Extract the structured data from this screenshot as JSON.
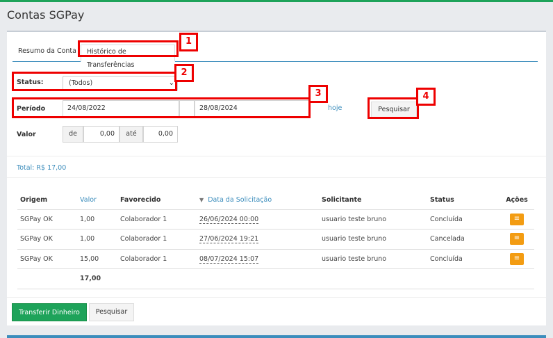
{
  "page": {
    "title": "Contas SGPay"
  },
  "tabs": [
    {
      "label": "Resumo da Conta"
    },
    {
      "label": "Histórico de Transferências"
    }
  ],
  "filters": {
    "status_label": "Status:",
    "status_value": "(Todos)",
    "periodo_label": "Período",
    "date_from": "24/08/2022",
    "date_to": "28/08/2024",
    "hoje_link": "hoje",
    "search_button": "Pesquisar",
    "valor_label": "Valor",
    "de_label": "de",
    "de_value": "0,00",
    "ate_label": "até",
    "ate_value": "0,00"
  },
  "total": "Total: R$ 17,00",
  "table": {
    "headers": [
      "Origem",
      "Valor",
      "Favorecido",
      "Data da Solicitação",
      "Solicitante",
      "Status",
      "Ações"
    ],
    "rows": [
      {
        "origem": "SGPay OK",
        "valor": "1,00",
        "favorecido": "Colaborador 1",
        "data": "26/06/2024 00:00",
        "solicitante": "usuario teste bruno",
        "status": "Concluída"
      },
      {
        "origem": "SGPay OK",
        "valor": "1,00",
        "favorecido": "Colaborador 1",
        "data": "27/06/2024 19:21",
        "solicitante": "usuario teste bruno",
        "status": "Cancelada"
      },
      {
        "origem": "SGPay OK",
        "valor": "15,00",
        "favorecido": "Colaborador 1",
        "data": "08/07/2024 15:07",
        "solicitante": "usuario teste bruno",
        "status": "Concluída"
      }
    ],
    "footer_total": "17,00"
  },
  "footer_buttons": {
    "transfer": "Transferir Dinheiro",
    "search": "Pesquisar"
  },
  "annotations": [
    "1",
    "2",
    "3",
    "4"
  ],
  "colors": {
    "accent": "#3c8dbc",
    "success": "#1ea35a",
    "warning": "#f39c12",
    "annotation": "#ee0000"
  },
  "icons": {
    "status_caret": "chevron-down-icon",
    "actions": "menu-icon",
    "sort": "sort-down-icon"
  }
}
